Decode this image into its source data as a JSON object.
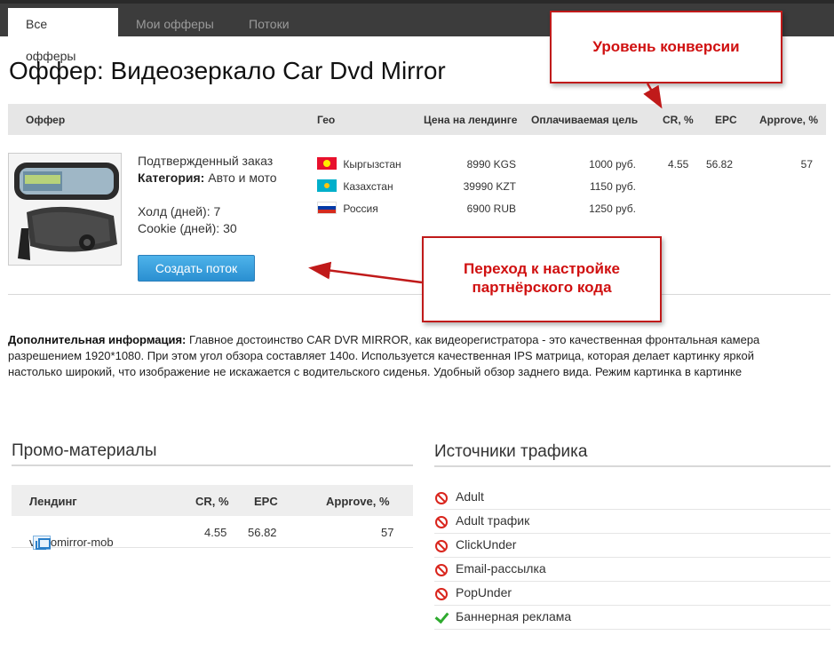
{
  "tabs": [
    {
      "label": "Все офферы",
      "active": true
    },
    {
      "label": "Мои офферы",
      "active": false
    },
    {
      "label": "Потоки",
      "active": false
    }
  ],
  "page_title": "Оффер: Видеозеркало Car Dvd Mirror",
  "offer_table": {
    "headers": {
      "offer": "Оффер",
      "geo": "Гео",
      "price": "Цена на лендинге",
      "goal": "Оплачиваемая цель",
      "cr": "CR, %",
      "epc": "EPC",
      "approve": "Approve, %"
    },
    "offer": {
      "goal_type": "Подтвержденный заказ",
      "category_label": "Категория:",
      "category_value": "Авто и мото",
      "hold": "Холд (дней): 7",
      "cookie": "Cookie (дней): 30",
      "create_button": "Создать поток"
    },
    "geo_rows": [
      {
        "country": "Кыргызстан",
        "flag": "flag-kyrgyzstan",
        "price": "8990 KGS",
        "payout": "1000 руб."
      },
      {
        "country": "Казахстан",
        "flag": "flag-kazakhstan",
        "price": "39990 KZT",
        "payout": "1150 руб."
      },
      {
        "country": "Россия",
        "flag": "flag-russia",
        "price": "6900 RUB",
        "payout": "1250 руб."
      }
    ],
    "stats": {
      "cr": "4.55",
      "epc": "56.82",
      "approve": "57"
    }
  },
  "extra_info": {
    "label": "Дополнительная информация:",
    "line1": "Главное достоинство CAR DVR MIRROR, как видеорегистратора - это качественная фронтальная камера",
    "line2": "разрешением 1920*1080. При этом угол обзора составляет 140о. Используется качественная IPS матрица, которая делает картинку яркой",
    "line3": "настолько широкий, что изображение не искажается с водительского сиденья. Удобный обзор заднего вида. Режим картинка в картинке"
  },
  "promo": {
    "title": "Промо-материалы",
    "headers": {
      "landing": "Лендинг",
      "cr": "CR, %",
      "epc": "EPC",
      "approve": "Approve, %"
    },
    "rows": [
      {
        "landing": "videomirror-mob",
        "cr": "4.55",
        "epc": "56.82",
        "approve": "57"
      }
    ]
  },
  "traffic": {
    "title": "Источники трафика",
    "items": [
      {
        "label": "Adult",
        "allowed": false
      },
      {
        "label": "Adult трафик",
        "allowed": false
      },
      {
        "label": "ClickUnder",
        "allowed": false
      },
      {
        "label": "Email-рассылка",
        "allowed": false
      },
      {
        "label": "PopUnder",
        "allowed": false
      },
      {
        "label": "Баннерная реклама",
        "allowed": true
      }
    ]
  },
  "annotations": {
    "conversion": "Уровень конверсии",
    "partner_line1": "Переход к настройке",
    "partner_line2": "партнёрского кода"
  },
  "colors": {
    "accent_button": "#2a8fd1",
    "annotation_red": "#d01010",
    "topbar": "#3c3c3c",
    "ban_red": "#d9251d",
    "check_green": "#2eaa2e"
  }
}
